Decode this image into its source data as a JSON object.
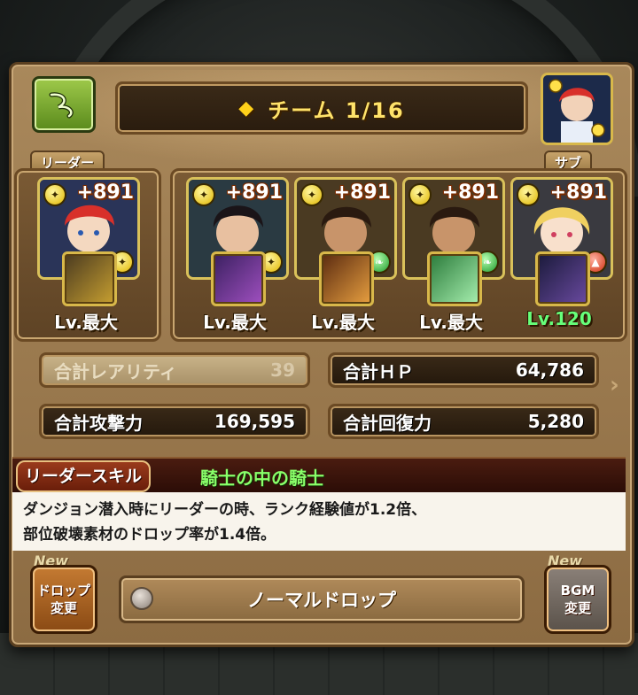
{
  "header": {
    "team_label": "チーム 1/16"
  },
  "tags": {
    "leader": "リーダー",
    "sub": "サブ"
  },
  "members": [
    {
      "role": "leader",
      "plus": "+891",
      "level": "Lv.最大",
      "attribute": "yellow",
      "sub_attribute": "yellow",
      "portrait_color": "#c8302a"
    },
    {
      "role": "sub",
      "plus": "+891",
      "level": "Lv.最大",
      "attribute": "yellow",
      "sub_attribute": "yellow",
      "portrait_color": "#2a2030"
    },
    {
      "role": "sub",
      "plus": "+891",
      "level": "Lv.最大",
      "attribute": "yellow",
      "sub_attribute": "green",
      "portrait_color": "#3a2818"
    },
    {
      "role": "sub",
      "plus": "+891",
      "level": "Lv.最大",
      "attribute": "yellow",
      "sub_attribute": "green",
      "portrait_color": "#3a2818"
    },
    {
      "role": "sub",
      "plus": "+891",
      "level": "Lv.120",
      "attribute": "yellow",
      "sub_attribute": "red",
      "portrait_color": "#f0d070"
    }
  ],
  "stats": {
    "rarity_label": "合計レアリティ",
    "rarity_value": "39",
    "hp_label": "合計ＨＰ",
    "hp_value": "64,786",
    "atk_label": "合計攻撃力",
    "atk_value": "169,595",
    "rcv_label": "合計回復力",
    "rcv_value": "5,280"
  },
  "leader_skill": {
    "label": "リーダースキル",
    "name": "騎士の中の騎士",
    "line1": "ダンジョン潜入時にリーダーの時、ランク経験値が1.2倍、",
    "line2": "部位破壊素材のドロップ率が1.4倍。"
  },
  "bottom": {
    "new_left": "New",
    "new_right": "New",
    "drop_btn_line1": "ドロップ",
    "drop_btn_line2": "変更",
    "drop_name": "ノーマルドロップ",
    "bgm_btn_line1": "BGM",
    "bgm_btn_line2": "変更"
  },
  "icons": {
    "back": "back-arrow-icon",
    "diamond": "diamond-icon",
    "attribute_light": "light-orb-icon",
    "attribute_wood": "wood-orb-icon",
    "attribute_fire": "fire-orb-icon"
  }
}
